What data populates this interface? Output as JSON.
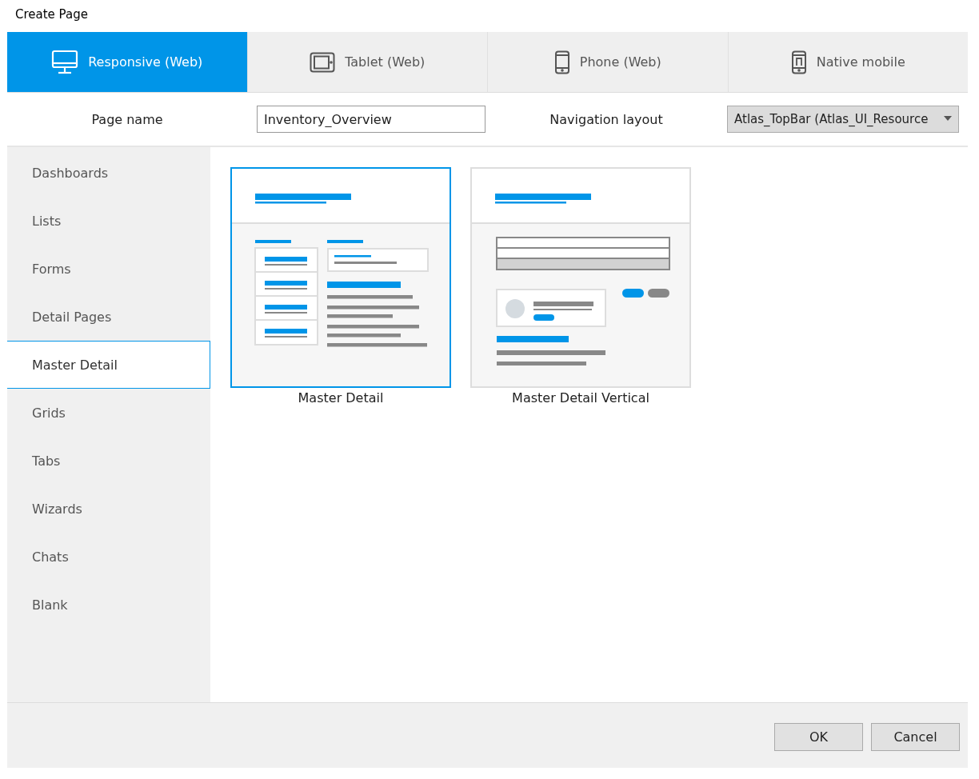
{
  "window": {
    "title": "Create Page"
  },
  "tabs": [
    {
      "label": "Responsive (Web)",
      "kind": "desktop",
      "selected": true
    },
    {
      "label": "Tablet (Web)",
      "kind": "tablet",
      "selected": false
    },
    {
      "label": "Phone (Web)",
      "kind": "phone",
      "selected": false
    },
    {
      "label": "Native mobile",
      "kind": "native",
      "selected": false
    }
  ],
  "form": {
    "page_name_label": "Page name",
    "page_name_value": "Inventory_Overview",
    "navigation_label": "Navigation layout",
    "navigation_value": "Atlas_TopBar (Atlas_UI_Resource"
  },
  "sidebar": {
    "items": [
      {
        "label": "Dashboards",
        "selected": false
      },
      {
        "label": "Lists",
        "selected": false
      },
      {
        "label": "Forms",
        "selected": false
      },
      {
        "label": "Detail Pages",
        "selected": false
      },
      {
        "label": "Master Detail",
        "selected": true
      },
      {
        "label": "Grids",
        "selected": false
      },
      {
        "label": "Tabs",
        "selected": false
      },
      {
        "label": "Wizards",
        "selected": false
      },
      {
        "label": "Chats",
        "selected": false
      },
      {
        "label": "Blank",
        "selected": false
      }
    ]
  },
  "templates": [
    {
      "label": "Master Detail",
      "kind": "master-detail",
      "selected": true
    },
    {
      "label": "Master Detail Vertical",
      "kind": "master-detail-vertical",
      "selected": false
    }
  ],
  "buttons": [
    "OK",
    "Cancel"
  ]
}
